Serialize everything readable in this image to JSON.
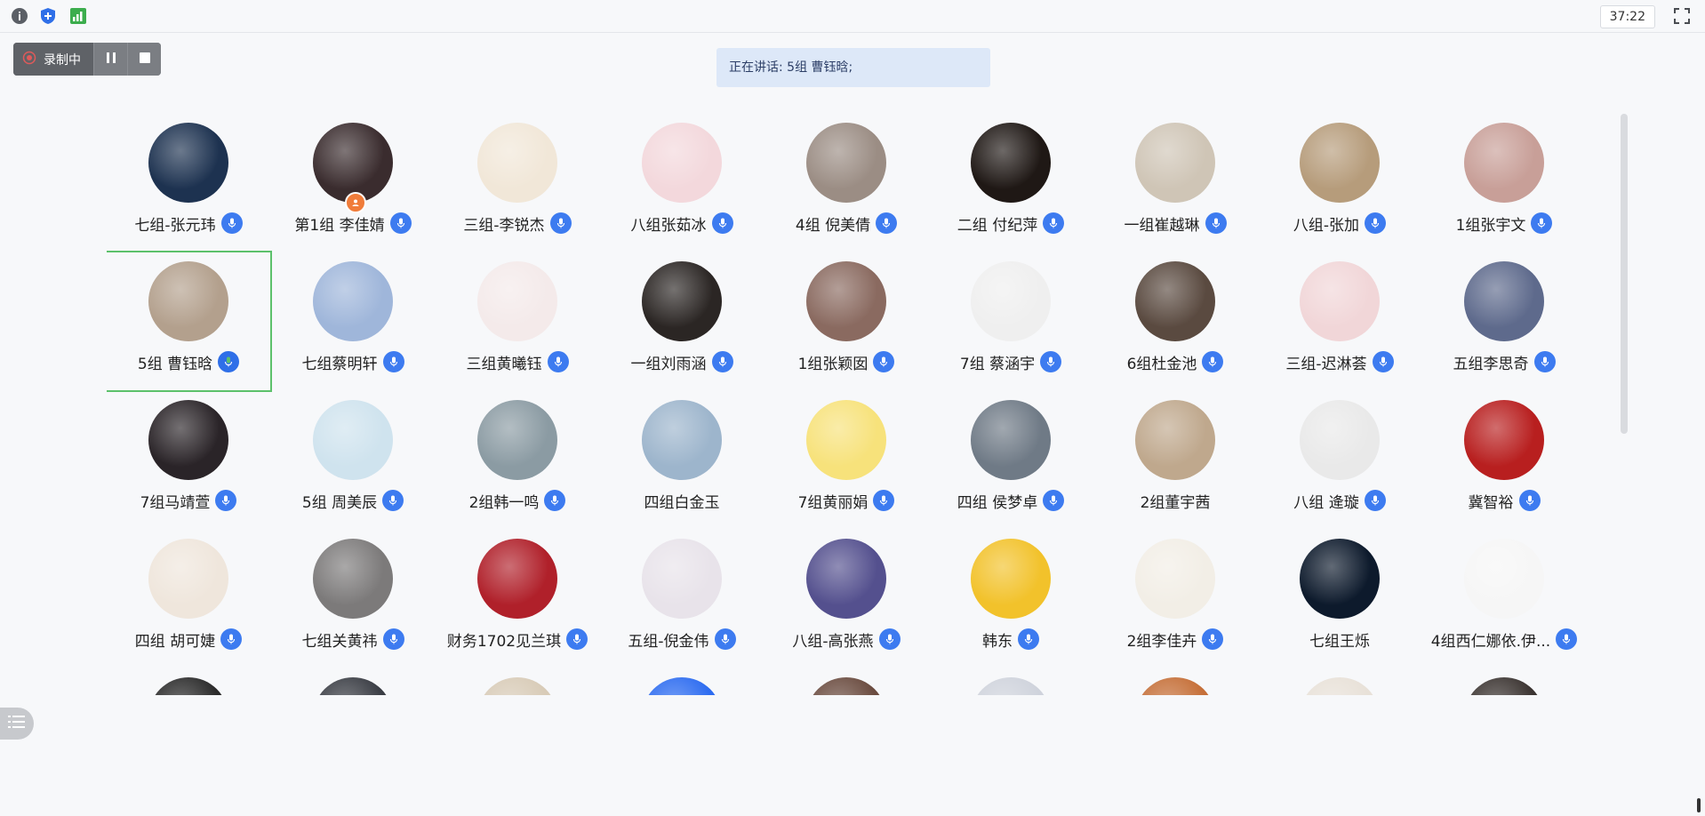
{
  "topbar": {
    "timer": "37:22",
    "icons": [
      "info-icon",
      "shield-icon",
      "signal-icon",
      "fullscreen-icon"
    ]
  },
  "recorder": {
    "status_label": "录制中",
    "buttons": [
      "pause-icon",
      "stop-icon"
    ]
  },
  "speaking_banner": "正在讲话: 5组 曹钰晗;",
  "colors": {
    "mic_blue": "#3d7bf0",
    "selected_border": "#5cc16b",
    "banner_bg": "#dde8f8"
  },
  "participants": [
    {
      "name": "七组-张元玮",
      "mic": true,
      "avatar_color": "#1d3250"
    },
    {
      "name": "第1组 李佳婧",
      "mic": true,
      "avatar_color": "#3a2c2e",
      "host_badge": true
    },
    {
      "name": "三组-李锐杰",
      "mic": true,
      "avatar_color": "#f1e7d8"
    },
    {
      "name": "八组张茹冰",
      "mic": true,
      "avatar_color": "#f3d8dc"
    },
    {
      "name": "4组 倪美倩",
      "mic": true,
      "avatar_color": "#9b8d84"
    },
    {
      "name": "二组 付纪萍",
      "mic": true,
      "avatar_color": "#1f1815"
    },
    {
      "name": "一组崔越琳",
      "mic": true,
      "avatar_color": "#cfc5b6"
    },
    {
      "name": "八组-张加",
      "mic": true,
      "avatar_color": "#b69c7b"
    },
    {
      "name": "1组张宇文",
      "mic": true,
      "avatar_color": "#c89f98"
    },
    {
      "name": "5组 曹钰晗",
      "mic": true,
      "speaking": true,
      "selected": true,
      "avatar_color": "#b3a08d"
    },
    {
      "name": "七组蔡明轩",
      "mic": true,
      "avatar_color": "#9fb6da"
    },
    {
      "name": "三组黄曦钰",
      "mic": true,
      "avatar_color": "#f4eaea"
    },
    {
      "name": "一组刘雨涵",
      "mic": true,
      "avatar_color": "#2b2624"
    },
    {
      "name": "1组张颖囡",
      "mic": true,
      "avatar_color": "#8a6a60"
    },
    {
      "name": "7组 蔡涵宇",
      "mic": true,
      "avatar_color": "#efefef"
    },
    {
      "name": "6组杜金池",
      "mic": true,
      "avatar_color": "#5a4a40"
    },
    {
      "name": "三组-迟淋荟",
      "mic": true,
      "avatar_color": "#f1d6d8"
    },
    {
      "name": "五组李思奇",
      "mic": true,
      "avatar_color": "#5e6a8c"
    },
    {
      "name": "7组马靖萱",
      "mic": true,
      "avatar_color": "#2a2428"
    },
    {
      "name": "5组 周美辰",
      "mic": true,
      "avatar_color": "#cfe3ee"
    },
    {
      "name": "2组韩一鸣",
      "mic": true,
      "avatar_color": "#8b9ba3"
    },
    {
      "name": "四组白金玉",
      "mic": false,
      "avatar_color": "#9db5cc"
    },
    {
      "name": "7组黄丽娟",
      "mic": true,
      "avatar_color": "#f7e27b"
    },
    {
      "name": "四组 侯梦卓",
      "mic": true,
      "avatar_color": "#6f7a86"
    },
    {
      "name": "2组董宇茜",
      "mic": false,
      "avatar_color": "#bfa88d"
    },
    {
      "name": "八组 逄璇",
      "mic": true,
      "avatar_color": "#e9e9e9"
    },
    {
      "name": "冀智裕",
      "mic": true,
      "avatar_color": "#b81f1f"
    },
    {
      "name": "四组 胡可婕",
      "mic": true,
      "avatar_color": "#efe6dc"
    },
    {
      "name": "七组关黄祎",
      "mic": true,
      "avatar_color": "#7c7a7a"
    },
    {
      "name": "财务1702见兰琪",
      "mic": true,
      "avatar_color": "#b0202a"
    },
    {
      "name": "五组-倪金伟",
      "mic": true,
      "avatar_color": "#e8e3ea"
    },
    {
      "name": "八组-高张燕",
      "mic": true,
      "avatar_color": "#54508e"
    },
    {
      "name": "韩东",
      "mic": true,
      "avatar_color": "#f2c22b"
    },
    {
      "name": "2组李佳卉",
      "mic": true,
      "avatar_color": "#f2eee6"
    },
    {
      "name": "七组王烁",
      "mic": false,
      "avatar_color": "#0d1a2c"
    },
    {
      "name": "4组西仁娜依.伊...",
      "mic": true,
      "avatar_color": "#f6f6f6"
    },
    {
      "name": "",
      "mic": false,
      "avatar_color": "#2a2a2a"
    },
    {
      "name": "",
      "mic": false,
      "avatar_color": "#3a3d44"
    },
    {
      "name": "",
      "mic": false,
      "avatar_color": "#d8cbb7"
    },
    {
      "name": "",
      "mic": false,
      "avatar_color": "#2d6cf0"
    },
    {
      "name": "",
      "mic": false,
      "avatar_color": "#6a4b3f"
    },
    {
      "name": "",
      "mic": false,
      "avatar_color": "#cfd3dc"
    },
    {
      "name": "",
      "mic": false,
      "avatar_color": "#c56f38"
    },
    {
      "name": "",
      "mic": false,
      "avatar_color": "#e8e1d8"
    },
    {
      "name": "",
      "mic": false,
      "avatar_color": "#3b3431"
    }
  ]
}
